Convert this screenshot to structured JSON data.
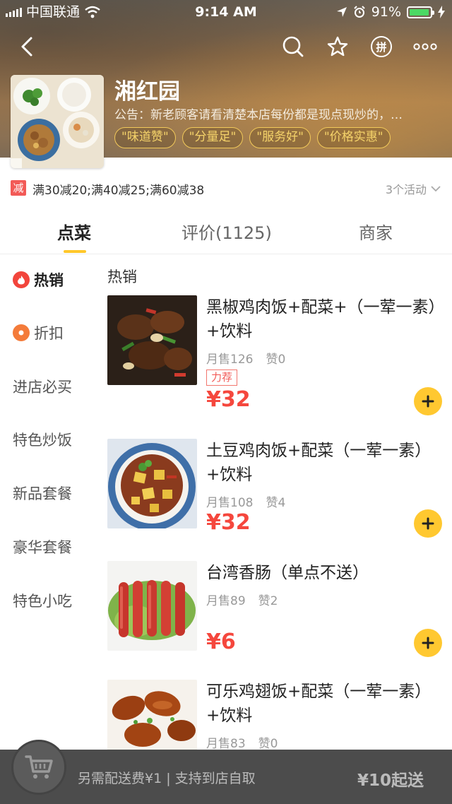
{
  "status_bar": {
    "carrier": "中国联通",
    "time": "9:14 AM",
    "battery": "91%"
  },
  "shop": {
    "name": "湘红园",
    "notice": "公告：新老顾客请看清楚本店每份都是现点现炒的，…",
    "tags": [
      "\"味道赞\"",
      "\"分量足\"",
      "\"服务好\"",
      "\"价格实惠\""
    ]
  },
  "promo": {
    "badge": "减",
    "text": "满30减20;满40减25;满60减38",
    "more": "3个活动"
  },
  "tabs": [
    {
      "label": "点菜"
    },
    {
      "label": "评价(1125)"
    },
    {
      "label": "商家"
    }
  ],
  "sidebar": {
    "items": [
      {
        "label": "热销"
      },
      {
        "label": "折扣"
      },
      {
        "label": "进店必买"
      },
      {
        "label": "特色炒饭"
      },
      {
        "label": "新品套餐"
      },
      {
        "label": "豪华套餐"
      },
      {
        "label": "特色小吃"
      }
    ]
  },
  "menu": {
    "section_title": "热销",
    "dishes": [
      {
        "name": "黑椒鸡肉饭+配菜+（一荤一素）+饮料",
        "sold": "月售126",
        "likes": "赞0",
        "rec": "力荐",
        "price": "¥32"
      },
      {
        "name": "土豆鸡肉饭+配菜（一荤一素）+饮料",
        "sold": "月售108",
        "likes": "赞4",
        "price": "¥32"
      },
      {
        "name": "台湾香肠（单点不送）",
        "sold": "月售89",
        "likes": "赞2",
        "price": "¥6"
      },
      {
        "name": "可乐鸡翅饭+配菜（一荤一素）+饮料",
        "sold": "月售83",
        "likes": "赞0"
      }
    ]
  },
  "cart": {
    "fee_text": "另需配送费¥1 | 支持到店自取",
    "min_order": "¥10起送"
  },
  "colors": {
    "accent": "#ffc830",
    "price": "#f5473d",
    "promo_badge": "#f25a57"
  }
}
